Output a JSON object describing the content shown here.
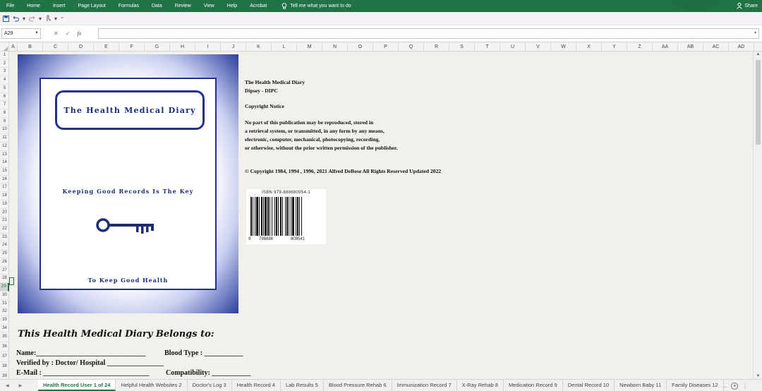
{
  "menubar": {
    "tabs": [
      "File",
      "Home",
      "Insert",
      "Page Layout",
      "Formulas",
      "Data",
      "Review",
      "View",
      "Help",
      "Acrobat"
    ],
    "tell_me": "Tell me what you want to do",
    "share": "Share"
  },
  "formula_bar": {
    "name_box": "A29",
    "fx_label": "fx",
    "formula_value": ""
  },
  "columns": [
    "A",
    "B",
    "C",
    "D",
    "E",
    "F",
    "G",
    "H",
    "I",
    "J",
    "K",
    "L",
    "M",
    "N",
    "O",
    "P",
    "Q",
    "R",
    "S",
    "T",
    "U",
    "V",
    "W",
    "X",
    "Y",
    "Z",
    "AA",
    "AB",
    "AC",
    "AD"
  ],
  "rows": [
    "1",
    "2",
    "3",
    "4",
    "5",
    "6",
    "7",
    "8",
    "9",
    "10",
    "11",
    "12",
    "13",
    "14",
    "15",
    "16",
    "17",
    "18",
    "19",
    "20",
    "21",
    "22",
    "23",
    "24",
    "25",
    "26",
    "27",
    "28",
    "29",
    "30",
    "31",
    "32",
    "33",
    "34",
    "35",
    "36",
    "37",
    "38",
    "39"
  ],
  "selected_row": "29",
  "cover": {
    "title": "The Health Medical Diary",
    "subtitle": "Keeping Good Records Is The Key",
    "footer": "To Keep Good Health"
  },
  "copyright": {
    "line1": "The Health Medical Diary",
    "line2": "Dipsey - DIPC",
    "line3": "Copyright Notice",
    "p1": "No part of this publication may be reproduced, stored in",
    "p2": "a retrieval system, or transmitted, in any form by any means,",
    "p3": "electronic, computer, mechanical, photocopying, recording,",
    "p4": "or otherwise, without the prior written permission of the publisher.",
    "notice": "© Copyright 1984, 1994 , 1996, 2021  Alfred DeBose   All Rights Reserved   Updated 2022"
  },
  "barcode": {
    "isbn": "ISBN 979-888680954-1",
    "digit_first": "9",
    "digits_left": "798886",
    "digits_right": "809541"
  },
  "owner": {
    "title": "This Health Medical Diary Belongs to:",
    "name": "Name:_______________________________",
    "blood_type": "Blood Type : ___________",
    "verified": "Verified by : Doctor/ Hospital ________________",
    "email": "E-Mail : ______________________________",
    "compatibility": "Compatibility: ___________"
  },
  "sheet_tabs": [
    "Health Record User 1 of 24",
    "Helpful Health Websites 2",
    "Doctor's Log 3",
    "Health Record 4",
    "Lab Results 5",
    "Blood Pressure Rehab 6",
    "Immunization Record 7",
    "X-Ray Rehab 8",
    "Medication Record 9",
    "Dental Record 10",
    "Newborn Baby 11",
    "Family Diseases 12"
  ],
  "tabs_more": "..."
}
